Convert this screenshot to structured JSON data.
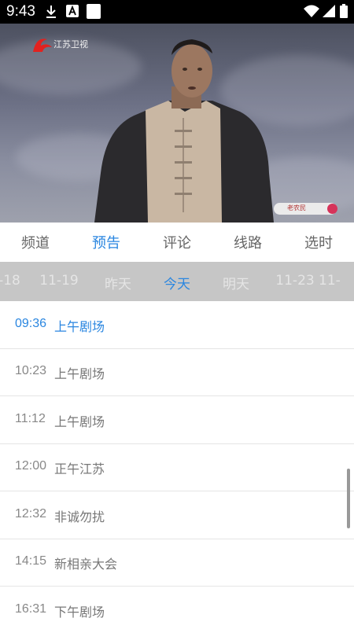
{
  "status_bar": {
    "time": "9:43",
    "left_icons": [
      "download-icon",
      "a-app-icon",
      "square-app-icon"
    ],
    "right_icons": [
      "wifi-icon",
      "signal-icon",
      "battery-icon"
    ]
  },
  "video": {
    "channel_logo_text": "江苏卫视",
    "watermark_text": "老农民"
  },
  "tabs": [
    {
      "label": "频道",
      "active": false
    },
    {
      "label": "预告",
      "active": true
    },
    {
      "label": "评论",
      "active": false
    },
    {
      "label": "线路",
      "active": false
    },
    {
      "label": "选时",
      "active": false
    }
  ],
  "dates": [
    {
      "label": "-18",
      "active": false
    },
    {
      "label": "11-19",
      "active": false
    },
    {
      "label": "昨天",
      "active": false
    },
    {
      "label": "今天",
      "active": true
    },
    {
      "label": "明天",
      "active": false
    },
    {
      "label": "11-23",
      "active": false
    },
    {
      "label": "11-",
      "active": false
    }
  ],
  "schedule": [
    {
      "time": "09:36",
      "title": "上午剧场",
      "current": true
    },
    {
      "time": "10:23",
      "title": "上午剧场",
      "current": false
    },
    {
      "time": "11:12",
      "title": "上午剧场",
      "current": false
    },
    {
      "time": "12:00",
      "title": "正午江苏",
      "current": false
    },
    {
      "time": "12:32",
      "title": "非诚勿扰",
      "current": false
    },
    {
      "time": "14:15",
      "title": "新相亲大会",
      "current": false
    },
    {
      "time": "16:31",
      "title": "下午剧场",
      "current": false
    }
  ],
  "colors": {
    "accent": "#2a86e0",
    "status_bar": "#000000",
    "date_bar": "#c6c6c6",
    "text_secondary": "#777777"
  }
}
